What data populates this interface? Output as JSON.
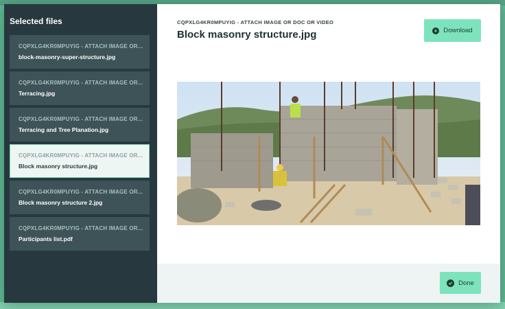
{
  "modal": {
    "sidebar_title": "Selected files",
    "files": [
      {
        "form": "CQPXLG4KR0MPUYIG - ATTACH IMAGE OR...",
        "name": "block-masonry-super-structure.jpg",
        "selected": false
      },
      {
        "form": "CQPXLG4KR0MPUYIG - ATTACH IMAGE OR...",
        "name": "Terracing.jpg",
        "selected": false
      },
      {
        "form": "CQPXLG4KR0MPUYIG - ATTACH IMAGE OR...",
        "name": "Terracing and Tree Planation.jpg",
        "selected": false
      },
      {
        "form": "CQPXLG4KR0MPUYIG - ATTACH IMAGE OR...",
        "name": "Block masonry structure.jpg",
        "selected": true
      },
      {
        "form": "CQPXLG4KR0MPUYIG - ATTACH IMAGE OR...",
        "name": "Block masonry structure 2.jpg",
        "selected": false
      },
      {
        "form": "CQPXLG4KR0MPUYIG - ATTACH IMAGE OR...",
        "name": "Participants list.pdf",
        "selected": false
      }
    ],
    "breadcrumb": "CQPXLG4KR0MPUYIG - ATTACH IMAGE OR DOC OR VIDEO",
    "title": "Block masonry structure.jpg",
    "download_label": "Download",
    "done_label": "Done",
    "icons": {
      "download": "download-icon",
      "done": "check-circle-icon"
    }
  },
  "colors": {
    "accent": "#7de3bc",
    "sidebar": "#27393e",
    "item": "#3e5357"
  }
}
